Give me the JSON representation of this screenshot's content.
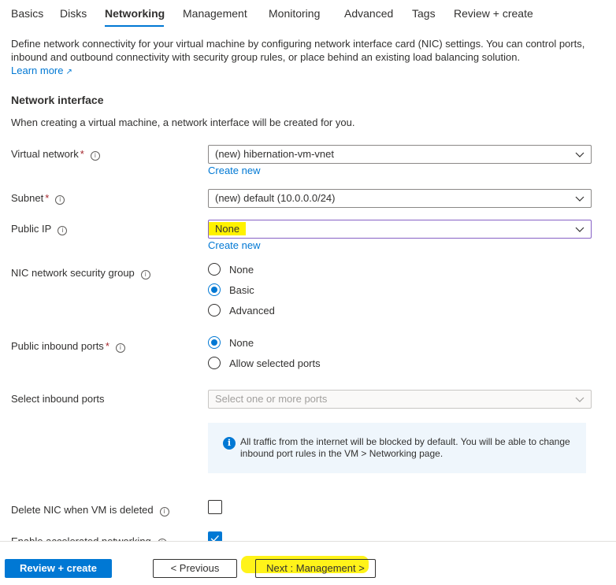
{
  "tabs": [
    {
      "label": "Basics",
      "active": false
    },
    {
      "label": "Disks",
      "active": false
    },
    {
      "label": "Networking",
      "active": true
    },
    {
      "label": "Management",
      "active": false
    },
    {
      "label": "Monitoring",
      "active": false
    },
    {
      "label": "Advanced",
      "active": false
    },
    {
      "label": "Tags",
      "active": false
    },
    {
      "label": "Review + create",
      "active": false
    }
  ],
  "intro": {
    "description": "Define network connectivity for your virtual machine by configuring network interface card (NIC) settings. You can control ports, inbound and outbound connectivity with security group rules, or place behind an existing load balancing solution.",
    "learn_more": "Learn more",
    "learn_more_icon": "external-link-icon"
  },
  "network_interface": {
    "title": "Network interface",
    "subtitle": "When creating a virtual machine, a network interface will be created for you."
  },
  "fields": {
    "virtual_network": {
      "label": "Virtual network",
      "required": "*",
      "value": "(new) hibernation-vm-vnet",
      "create_new": "Create new"
    },
    "subnet": {
      "label": "Subnet",
      "required": "*",
      "value": "(new) default (10.0.0.0/24)"
    },
    "public_ip": {
      "label": "Public IP",
      "value": "None",
      "create_new": "Create new"
    },
    "nic_nsg": {
      "label": "NIC network security group",
      "options": [
        "None",
        "Basic",
        "Advanced"
      ],
      "selected": "Basic"
    },
    "public_inbound_ports": {
      "label": "Public inbound ports",
      "required": "*",
      "options": [
        "None",
        "Allow selected ports"
      ],
      "selected": "None"
    },
    "select_inbound_ports": {
      "label": "Select inbound ports",
      "placeholder": "Select one or more ports",
      "disabled": true
    },
    "info_message": "All traffic from the internet will be blocked by default. You will be able to change inbound port rules in the VM > Networking page.",
    "delete_nic": {
      "label": "Delete NIC when VM is deleted",
      "checked": false
    },
    "accelerated_networking": {
      "label": "Enable accelerated networking",
      "checked": true
    }
  },
  "footer": {
    "review_create": "Review + create",
    "previous": "< Previous",
    "next": "Next : Management >"
  },
  "colors": {
    "accent": "#0078d4",
    "highlight": "#fff200",
    "required": "#a4262c"
  }
}
